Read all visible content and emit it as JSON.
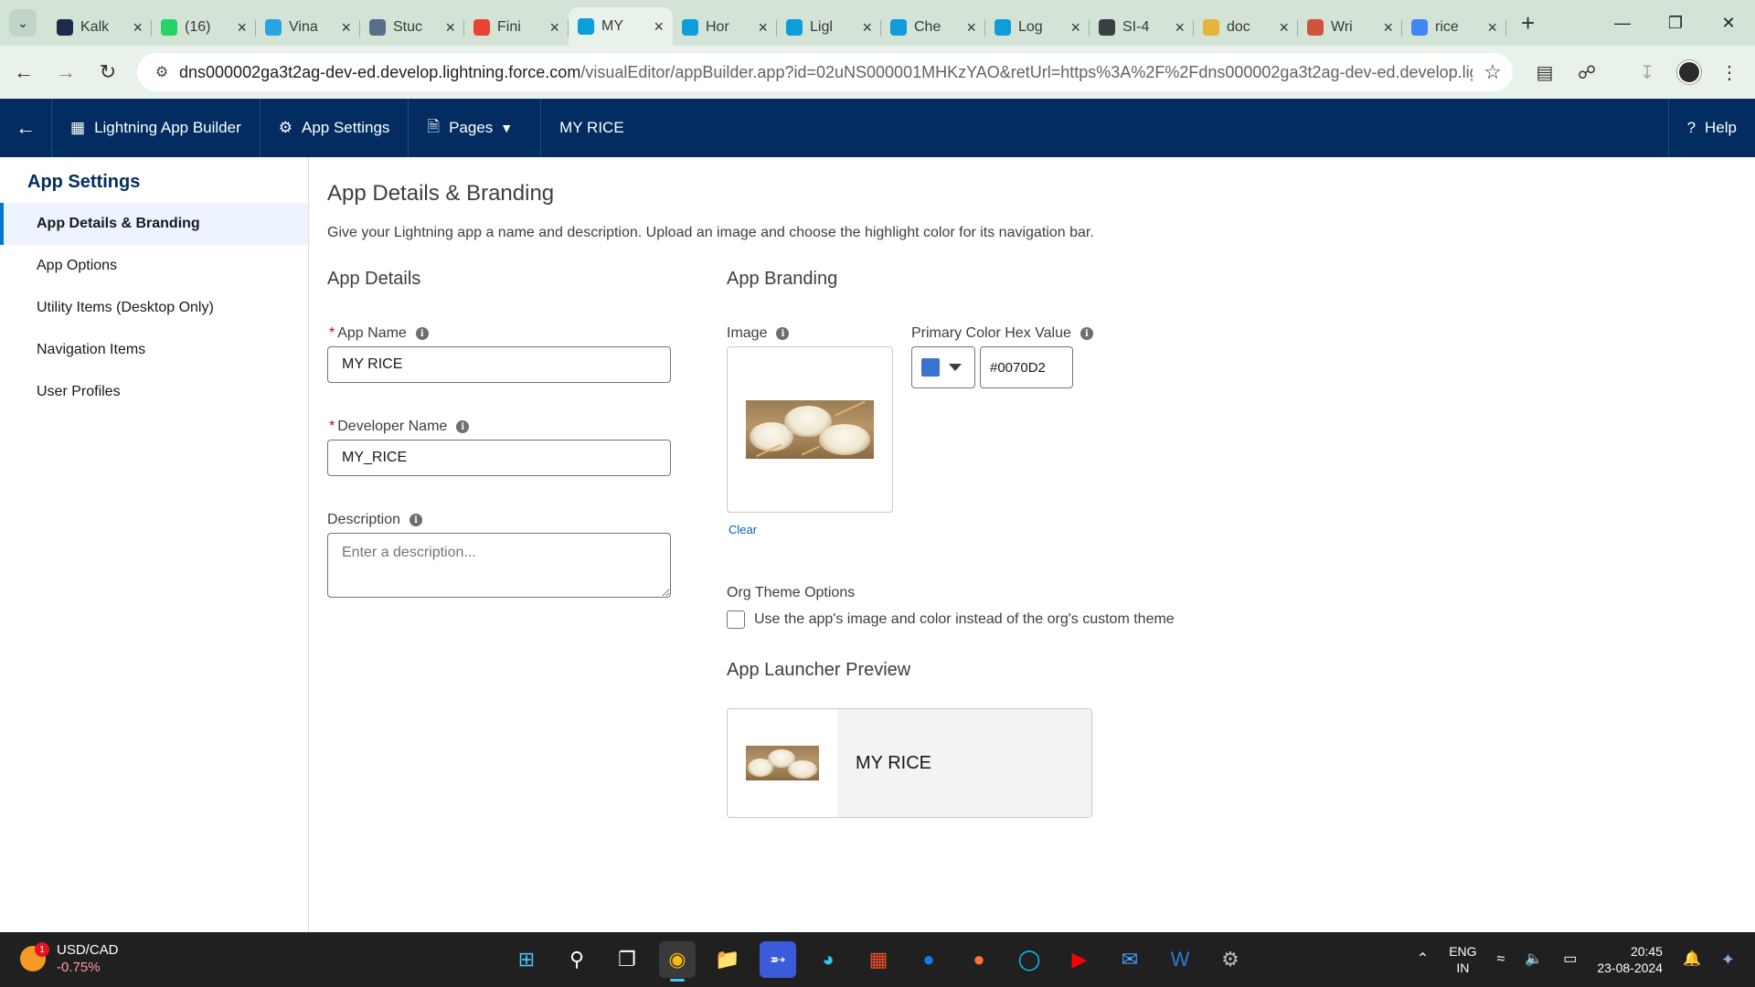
{
  "browser": {
    "tabs": [
      {
        "title": "Kalk",
        "color": "#1f2a4a"
      },
      {
        "title": "(16)",
        "color": "#25d366"
      },
      {
        "title": "Vina",
        "color": "#2aa3e0"
      },
      {
        "title": "Stuc",
        "color": "#5a6e8a"
      },
      {
        "title": "Fini",
        "color": "#ea4335"
      },
      {
        "title": "MY",
        "color": "#0d9dda",
        "active": true
      },
      {
        "title": "Hor",
        "color": "#0d9dda"
      },
      {
        "title": "Ligl",
        "color": "#0d9dda"
      },
      {
        "title": "Che",
        "color": "#0d9dda"
      },
      {
        "title": "Log",
        "color": "#0d9dda"
      },
      {
        "title": "SI-4",
        "color": "#3c4043"
      },
      {
        "title": "doc",
        "color": "#e5b53a"
      },
      {
        "title": "Wri",
        "color": "#d0533b"
      },
      {
        "title": "rice",
        "color": "#4285f4"
      }
    ],
    "url_host": "dns000002ga3t2ag-dev-ed.develop.lightning.force.com",
    "url_rest": "/visualEditor/appBuilder.app?id=02uNS000001MHKzYAO&retUrl=https%3A%2F%2Fdns000002ga3t2ag-dev-ed.develop.light..."
  },
  "header": {
    "app_builder": "Lightning App Builder",
    "app_settings": "App Settings",
    "pages": "Pages",
    "app_name": "MY RICE",
    "help": "Help"
  },
  "sidebar": {
    "heading": "App Settings",
    "items": [
      {
        "label": "App Details & Branding",
        "active": true
      },
      {
        "label": "App Options"
      },
      {
        "label": "Utility Items (Desktop Only)"
      },
      {
        "label": "Navigation Items"
      },
      {
        "label": "User Profiles"
      }
    ]
  },
  "main": {
    "title": "App Details & Branding",
    "description": "Give your Lightning app a name and description. Upload an image and choose the highlight color for its navigation bar.",
    "details": {
      "heading": "App Details",
      "app_name_label": "App Name",
      "app_name_value": "MY RICE",
      "developer_name_label": "Developer Name",
      "developer_name_value": "MY_RICE",
      "description_label": "Description",
      "description_placeholder": "Enter a description..."
    },
    "branding": {
      "heading": "App Branding",
      "image_label": "Image",
      "clear": "Clear",
      "primary_color_label": "Primary Color Hex Value",
      "primary_color_value": "#0070D2",
      "swatch_color": "#3a72d0",
      "org_theme_label": "Org Theme Options",
      "org_theme_checkbox": "Use the app's image and color instead of the org's custom theme",
      "org_theme_checked": false
    },
    "preview": {
      "heading": "App Launcher Preview",
      "app_name": "MY RICE"
    }
  },
  "taskbar": {
    "ticker_symbol": "USD/CAD",
    "ticker_change": "-0.75%",
    "ticker_badge": "1",
    "lang_top": "ENG",
    "lang_bottom": "IN",
    "time": "20:45",
    "date": "23-08-2024"
  }
}
